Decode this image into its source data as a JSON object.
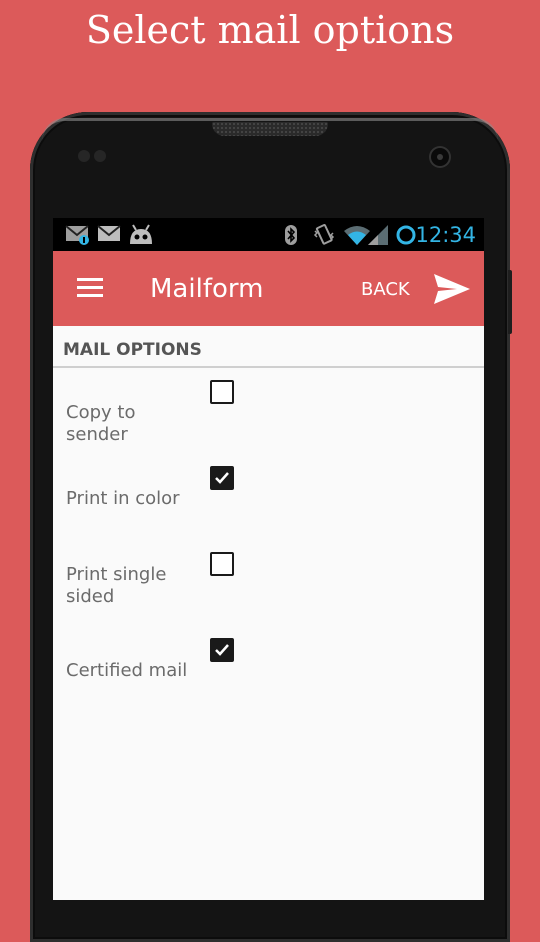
{
  "headline": "Select mail options",
  "status_bar": {
    "time": "12:34",
    "icons": [
      "mail-notification-icon",
      "mail-icon",
      "android-icon",
      "bluetooth-icon",
      "vibrate-icon",
      "wifi-icon",
      "signal-icon",
      "sync-ring-icon"
    ]
  },
  "toolbar": {
    "title": "Mailform",
    "back_label": "BACK",
    "menu_icon": "hamburger-menu-icon",
    "send_icon": "send-icon"
  },
  "section": {
    "title": "MAIL OPTIONS"
  },
  "options": [
    {
      "label": "Copy to sender",
      "checked": false
    },
    {
      "label": "Print in color",
      "checked": true
    },
    {
      "label": "Print single sided",
      "checked": false
    },
    {
      "label": "Certified mail",
      "checked": true
    }
  ],
  "colors": {
    "accent": "#dc5a5a",
    "clock": "#33b5e5",
    "screen_bg": "#fafafa",
    "label_text": "#6b6b6b",
    "checkbox": "#1a1a1a"
  }
}
